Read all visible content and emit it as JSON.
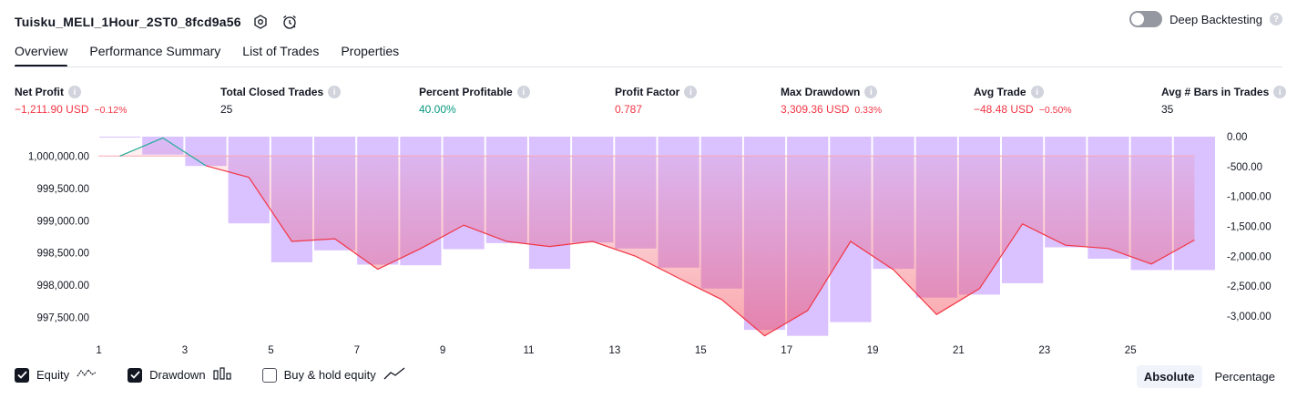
{
  "header": {
    "title": "Tuisku_MELI_1Hour_2ST0_8fcd9a56",
    "deep_backtesting_label": "Deep Backtesting",
    "deep_backtesting_on": false
  },
  "tabs": [
    {
      "label": "Overview",
      "active": true
    },
    {
      "label": "Performance Summary",
      "active": false
    },
    {
      "label": "List of Trades",
      "active": false
    },
    {
      "label": "Properties",
      "active": false
    }
  ],
  "stats": [
    {
      "label": "Net Profit",
      "value": "−1,211.90 USD",
      "pct": "−0.12%",
      "color": "#f23645"
    },
    {
      "label": "Total Closed Trades",
      "value": "25",
      "pct": "",
      "color": "#131722"
    },
    {
      "label": "Percent Profitable",
      "value": "40.00%",
      "pct": "",
      "color": "#089981"
    },
    {
      "label": "Profit Factor",
      "value": "0.787",
      "pct": "",
      "color": "#f23645"
    },
    {
      "label": "Max Drawdown",
      "value": "3,309.36 USD",
      "pct": "0.33%",
      "color": "#f23645"
    },
    {
      "label": "Avg Trade",
      "value": "−48.48 USD",
      "pct": "−0.50%",
      "color": "#f23645"
    },
    {
      "label": "Avg # Bars in Trades",
      "value": "35",
      "pct": "",
      "color": "#131722"
    }
  ],
  "chart_data": {
    "type": "line",
    "x": [
      1,
      2,
      3,
      4,
      5,
      6,
      7,
      8,
      9,
      10,
      11,
      12,
      13,
      14,
      15,
      16,
      17,
      18,
      19,
      20,
      21,
      22,
      23,
      24,
      25,
      26
    ],
    "x_ticks": [
      "1",
      "3",
      "5",
      "7",
      "9",
      "11",
      "13",
      "15",
      "17",
      "19",
      "21",
      "23",
      "25"
    ],
    "left_ylim": [
      997200,
      1000300
    ],
    "left_ticks": [
      "1,000,000.00",
      "999,500.00",
      "999,000.00",
      "998,500.00",
      "998,000.00",
      "997,500.00"
    ],
    "left_tick_values": [
      1000000,
      999500,
      999000,
      998500,
      998000,
      997500
    ],
    "right_ylim": [
      -3350,
      0
    ],
    "right_ticks": [
      "0.00",
      "-500.00",
      "-1,000.00",
      "-1,500.00",
      "-2,000.00",
      "-2,500.00",
      "-3,000.00"
    ],
    "right_tick_values": [
      0,
      -500,
      -1000,
      -1500,
      -2000,
      -2500,
      -3000
    ],
    "series": [
      {
        "name": "Equity",
        "axis": "left",
        "color": "#f23645",
        "values": [
          1000000,
          1000280,
          999850,
          999670,
          998680,
          998720,
          998250,
          998570,
          998930,
          998680,
          998600,
          998680,
          998450,
          998110,
          997780,
          997220,
          997610,
          998680,
          998240,
          997550,
          997950,
          998950,
          998620,
          998570,
          998330,
          998700
        ]
      },
      {
        "name": "Drawdown",
        "axis": "right",
        "color": "#d1b2ff",
        "values": [
          0,
          -300,
          -490,
          -1450,
          -2100,
          -1900,
          -2140,
          -2150,
          -1880,
          -1780,
          -2210,
          -1770,
          -1870,
          -2190,
          -2540,
          -3230,
          -3330,
          -3100,
          -2210,
          -2690,
          -2640,
          -2450,
          -1850,
          -2040,
          -2230,
          -2230
        ]
      }
    ],
    "grid": false
  },
  "legend": [
    {
      "label": "Equity",
      "checked": true,
      "icon": "equity-wave-icon"
    },
    {
      "label": "Drawdown",
      "checked": true,
      "icon": "drawdown-bars-icon"
    },
    {
      "label": "Buy & hold equity",
      "checked": false,
      "icon": "buy-hold-line-icon"
    }
  ],
  "mode": {
    "absolute": "Absolute",
    "percentage": "Percentage",
    "active": "absolute"
  }
}
